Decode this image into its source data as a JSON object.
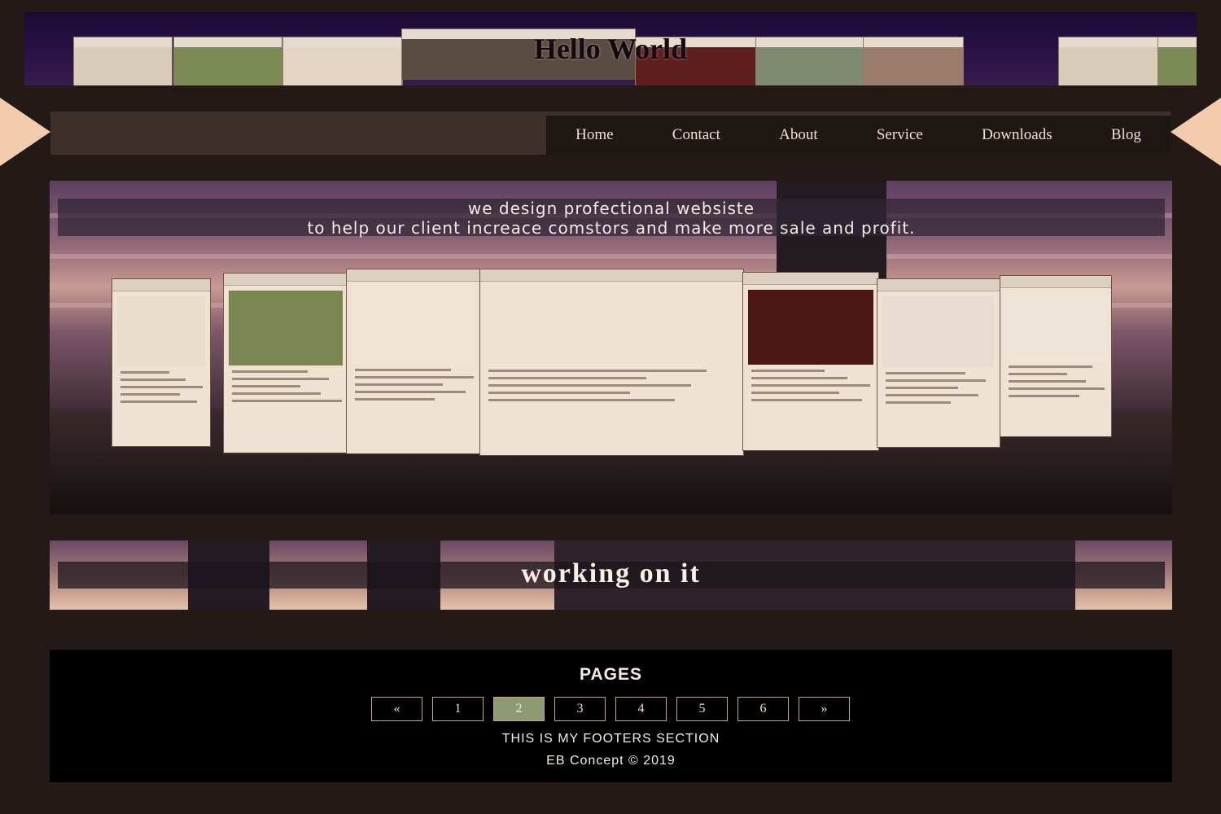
{
  "header": {
    "title": "Hello World",
    "card_colors": [
      "#d8ccb8",
      "#7c8a54",
      "#e5d6c3",
      "#5a4b43",
      "#5e1f1e",
      "#7f8a70",
      "#9a7b6c",
      "#d8ccb8",
      "#7c8a54"
    ]
  },
  "nav": {
    "items": [
      {
        "label": "Home"
      },
      {
        "label": "Contact"
      },
      {
        "label": "About"
      },
      {
        "label": "Service"
      },
      {
        "label": "Downloads"
      },
      {
        "label": "Blog"
      }
    ]
  },
  "hero": {
    "line1": "we design profectional websiste",
    "line2": "to help our client increace comstors and make more sale and profit.",
    "card_colors": [
      "#e9dccb",
      "#7b8550",
      "#f0e3d4",
      "#efe2d2",
      "#4e1717",
      "#e7dccf",
      "#efe4d8"
    ]
  },
  "section": {
    "title": "working on it"
  },
  "footer": {
    "pages_title": "PAGES",
    "pages": [
      "«",
      "1",
      "2",
      "3",
      "4",
      "5",
      "6",
      "»"
    ],
    "active_page": "2",
    "text": "THIS IS MY FOOTERS SECTION",
    "copyright": "EB Concept © 2019"
  },
  "colors": {
    "background": "#231a17",
    "nav_bar": "#3d302a",
    "accent_triangle": "#f3cbad",
    "active_page": "#8d9a74"
  }
}
